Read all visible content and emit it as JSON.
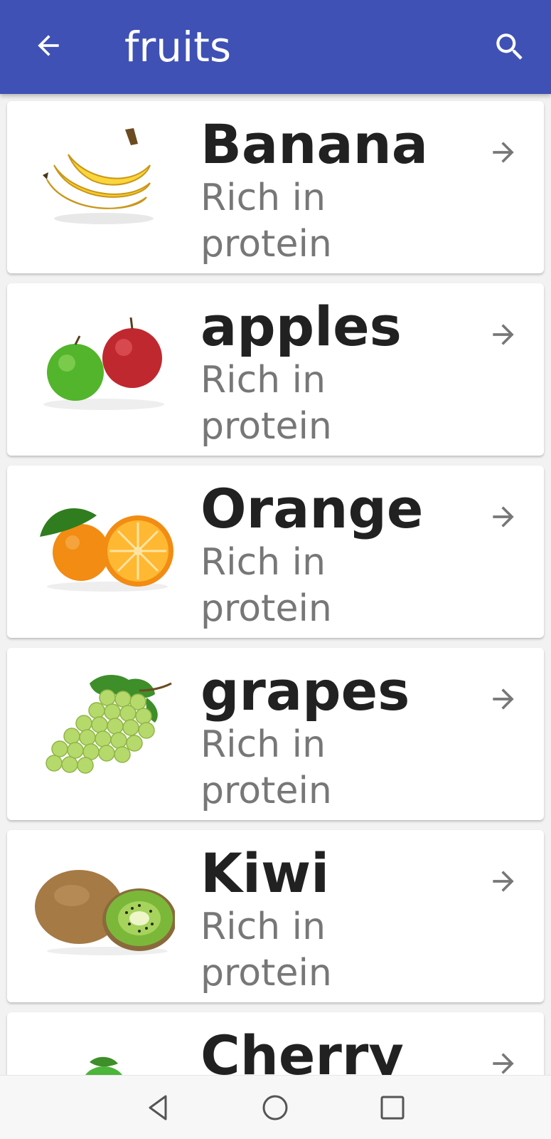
{
  "appbar": {
    "title": "fruits",
    "background": "#3f51b5",
    "back_icon": "arrow-left-icon",
    "search_icon": "search-icon"
  },
  "fruits": [
    {
      "name": "Banana",
      "desc": "Rich in protein",
      "image": "banana-image"
    },
    {
      "name": "apples",
      "desc": "Rich in protein",
      "image": "apples-image"
    },
    {
      "name": "Orange",
      "desc": "Rich in protein",
      "image": "orange-image"
    },
    {
      "name": "grapes",
      "desc": "Rich in protein",
      "image": "grapes-image"
    },
    {
      "name": "Kiwi",
      "desc": "Rich in protein",
      "image": "kiwi-image"
    },
    {
      "name": "Cherry",
      "desc": "",
      "image": "cherry-image"
    }
  ],
  "navbar": {
    "back_icon": "triangle-back-icon",
    "home_icon": "circle-home-icon",
    "recents_icon": "square-recents-icon"
  }
}
